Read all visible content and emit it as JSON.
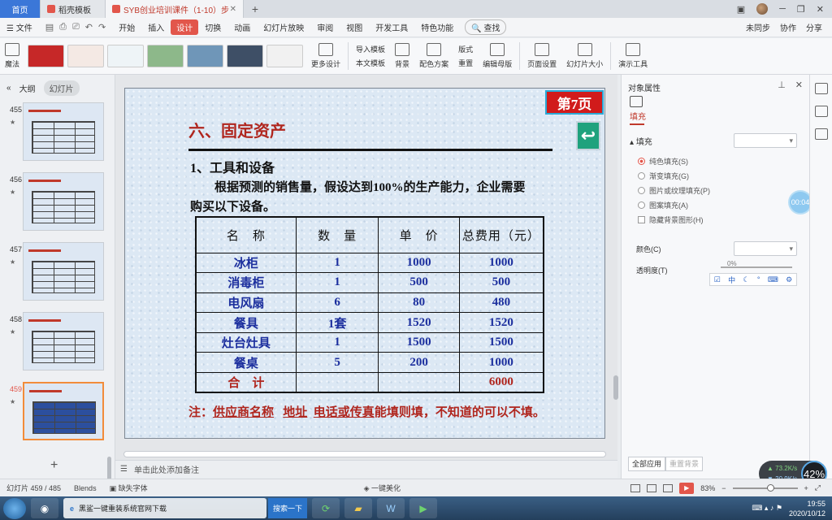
{
  "tabs": {
    "home": "首页",
    "templates": "稻壳模板",
    "active_doc": "SYB创业培训课件（1-10）步"
  },
  "menu": {
    "file": "文件",
    "items": [
      "开始",
      "插入",
      "设计",
      "切换",
      "动画",
      "幻灯片放映",
      "审阅",
      "视图",
      "开发工具",
      "特色功能"
    ],
    "selected": "设计",
    "search": "查找",
    "right": [
      "未同步",
      "协作",
      "分享"
    ]
  },
  "ribbon": {
    "magic": "魔法",
    "more_design": "更多设计",
    "import_template": "导入模板",
    "text_template": "本文模板",
    "background": "背景",
    "color_scheme": "配色方案",
    "layout": "版式",
    "reset": "重置",
    "edit_master": "编辑母版",
    "page_setup": "页面设置",
    "slide_size": "幻灯片大小",
    "present_tools": "演示工具"
  },
  "left_panel": {
    "outline": "大纲",
    "slides": "幻灯片",
    "thumbs": [
      {
        "num": "455",
        "star": "★"
      },
      {
        "num": "456",
        "star": "★"
      },
      {
        "num": "457",
        "star": "★"
      },
      {
        "num": "458",
        "star": "★"
      },
      {
        "num": "459",
        "star": "★"
      }
    ]
  },
  "slide": {
    "page_badge": "第7页",
    "title": "六、固定资产",
    "subtitle": "1、工具和设备",
    "para_line1": "根据预测的销售量，假设达到100%的生产能力，企业需要",
    "para_line2": "购买以下设备。",
    "table": {
      "headers": [
        "名　称",
        "数　量",
        "单　价",
        "总费用（元）"
      ],
      "rows": [
        [
          "冰柜",
          "1",
          "1000",
          "1000"
        ],
        [
          "消毒柜",
          "1",
          "500",
          "500"
        ],
        [
          "电风扇",
          "6",
          "80",
          "480"
        ],
        [
          "餐具",
          "1套",
          "1520",
          "1520"
        ],
        [
          "灶台灶具",
          "1",
          "1500",
          "1500"
        ],
        [
          "餐桌",
          "5",
          "200",
          "1000"
        ]
      ],
      "total": [
        "合　计",
        "",
        "",
        "6000"
      ]
    },
    "note_prefix": "注：",
    "note_supplier": "供应商名称",
    "note_address": "地址",
    "note_phone": "电话或传真",
    "note_suffix": "能填则填，不知道的可以不填。"
  },
  "notes_placeholder": "单击此处添加备注",
  "right_panel": {
    "title": "对象属性",
    "tab": "填充",
    "section": "填充",
    "options": [
      "纯色填充(S)",
      "渐变填充(G)",
      "图片或纹理填充(P)",
      "图案填充(A)"
    ],
    "hide_bg": "隐藏背景图形(H)",
    "color_label": "颜色(C)",
    "transparency_label": "透明度(T)",
    "transparency_value": "0%",
    "timer": "00:04",
    "apply_all": "全部应用",
    "reset_bg": "重置背景"
  },
  "net": {
    "up": "73.2K/s",
    "down": "20.9K/s",
    "percent": "42%"
  },
  "status": {
    "slide_pos": "幻灯片 459 / 485",
    "theme": "Blends",
    "font_missing": "缺失字体",
    "beautify": "一键美化",
    "zoom": "83%"
  },
  "taskbar": {
    "task_label": "黑鲨一键重装系统官网下载",
    "search": "搜索一下",
    "time": "19:55",
    "date": "2020/10/12"
  }
}
